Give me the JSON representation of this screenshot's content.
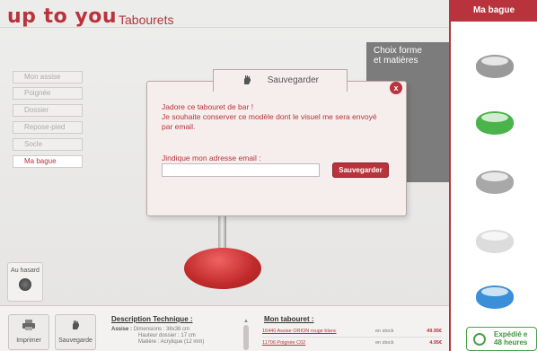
{
  "header": {
    "brand": "up to you",
    "category": "Tabourets"
  },
  "right_panel": {
    "title": "Ma bague",
    "rings": [
      {
        "name": "ring-silver-gems",
        "color": "#9a9a9a"
      },
      {
        "name": "ring-green",
        "color": "#4ab34a"
      },
      {
        "name": "ring-gray",
        "color": "#a8a8a8"
      },
      {
        "name": "ring-white",
        "color": "#dcdcdc"
      },
      {
        "name": "ring-blue",
        "color": "#3a8fd8"
      }
    ]
  },
  "menu": {
    "title_line1": "Choix forme",
    "title_line2": "et matières",
    "items": [
      {
        "label": "Mon assise"
      },
      {
        "label": "Poignée"
      },
      {
        "label": "Dossier"
      },
      {
        "label": "Repose-pied"
      },
      {
        "label": "Socle"
      },
      {
        "label": "Ma bague",
        "selected": true
      }
    ]
  },
  "random": {
    "label": "Au hasard"
  },
  "dialog": {
    "tab_title": "Sauvegarder",
    "close": "x",
    "message_line1": "Jadore ce tabouret de bar !",
    "message_line2": "Je souhaite conserver ce modèle dont le visuel me sera envoyé",
    "message_line3": "par email.",
    "email_label": "Jindique mon adresse email :",
    "email_value": "",
    "email_placeholder": "",
    "save_label": "Sauvegarder"
  },
  "toolbar": {
    "print_label": "Imprimer",
    "save_label": "Sauvegarde"
  },
  "description": {
    "title": "Description Technique :",
    "assise_label": "Assise :",
    "line1": "Dimensions : 38x38 cm",
    "line2": "Hauteur dossier : 17 cm",
    "line3": "Matière : Acrylique (12 mm)"
  },
  "my_stool": {
    "title": "Mon tabouret :",
    "rows": [
      {
        "name": "16440 Assise ORION rouge blanc",
        "stock": "en stock",
        "price": "49.95€"
      },
      {
        "name": "11706 Poignée C02",
        "stock": "en stock",
        "price": "4.95€"
      }
    ]
  },
  "shipping": {
    "line1": "Expédié e",
    "line2": "48 heures"
  },
  "colors": {
    "accent": "#b8333b",
    "green": "#4aa04a",
    "base": "#c12a2a"
  }
}
